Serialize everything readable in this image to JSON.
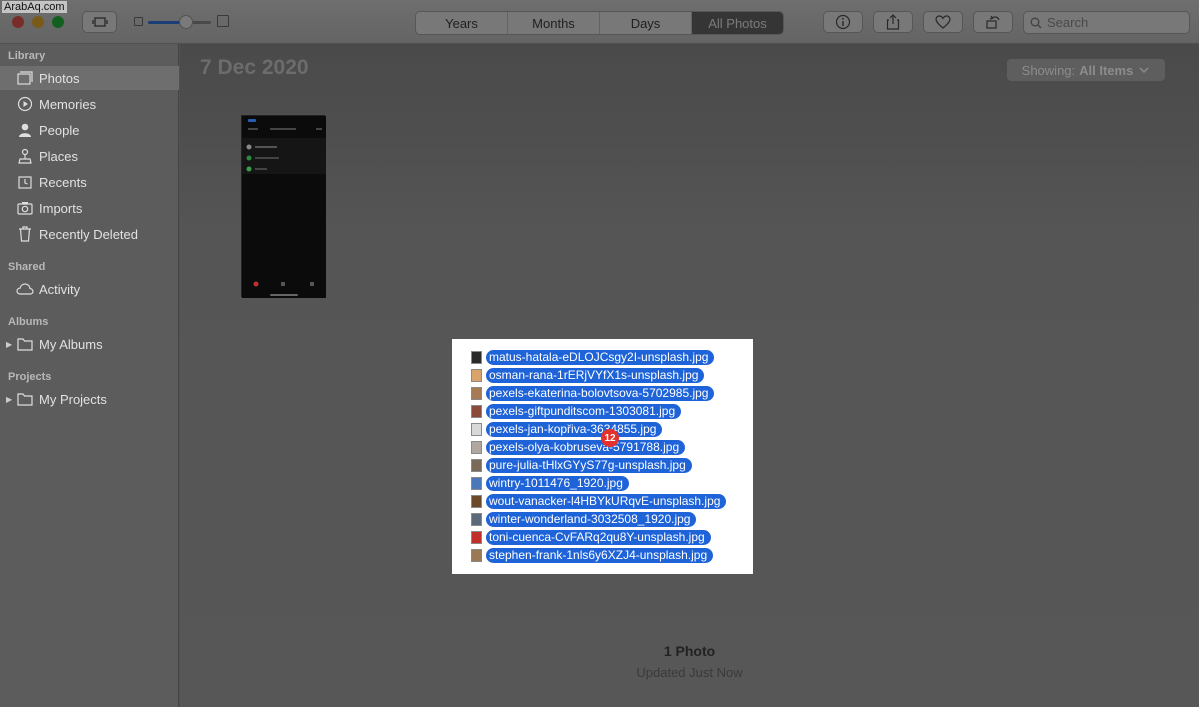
{
  "watermark": "ArabAq.com",
  "toolbar": {
    "view_tabs": [
      "Years",
      "Months",
      "Days",
      "All Photos"
    ],
    "active_tab": "All Photos",
    "search_placeholder": "Search",
    "zoom_level": 0.6
  },
  "sidebar": {
    "sections": {
      "library": "Library",
      "shared": "Shared",
      "albums": "Albums",
      "projects": "Projects"
    },
    "library_items": [
      {
        "label": "Photos",
        "icon": "photos-icon"
      },
      {
        "label": "Memories",
        "icon": "memories-icon"
      },
      {
        "label": "People",
        "icon": "people-icon"
      },
      {
        "label": "Places",
        "icon": "places-icon"
      },
      {
        "label": "Recents",
        "icon": "recents-icon"
      },
      {
        "label": "Imports",
        "icon": "imports-icon"
      },
      {
        "label": "Recently Deleted",
        "icon": "trash-icon"
      }
    ],
    "shared_items": [
      {
        "label": "Activity",
        "icon": "cloud-icon"
      }
    ],
    "album_items": [
      {
        "label": "My Albums",
        "icon": "folder-icon"
      }
    ],
    "project_items": [
      {
        "label": "My Projects",
        "icon": "folder-icon"
      }
    ]
  },
  "main": {
    "date_title": "7 Dec 2020",
    "showing_label": "Showing:",
    "showing_value": "All Items",
    "photo_count": "1 Photo",
    "status": "Updated Just Now"
  },
  "drag": {
    "badge_count": "12",
    "files": [
      "matus-hatala-eDLOJCsgy2I-unsplash.jpg",
      "osman-rana-1rERjVYfX1s-unsplash.jpg",
      "pexels-ekaterina-bolovtsova-5702985.jpg",
      "pexels-giftpunditscom-1303081.jpg",
      "pexels-jan-kopřiva-3634855.jpg",
      "pexels-olya-kobruseva-5791788.jpg",
      "pure-julia-tHlxGYyS77g-unsplash.jpg",
      "wintry-1011476_1920.jpg",
      "wout-vanacker-l4HBYkURqvE-unsplash.jpg",
      "winter-wonderland-3032508_1920.jpg",
      "toni-cuenca-CvFARq2qu8Y-unsplash.jpg",
      "stephen-frank-1nls6y6XZJ4-unsplash.jpg"
    ],
    "thumb_colors": [
      "#2a2a2a",
      "#d9a46b",
      "#a67b55",
      "#8c4a3a",
      "#d8d8d8",
      "#b0a8a0",
      "#7a6a5a",
      "#4a78b8",
      "#6b4a2a",
      "#5a6a7a",
      "#c0302a",
      "#9a7a55"
    ]
  }
}
